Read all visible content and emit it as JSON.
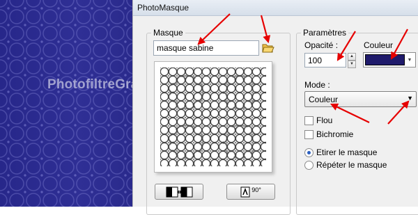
{
  "window": {
    "title": "PhotoMasque"
  },
  "watermark": {
    "text": "PhotofiltreGraph"
  },
  "masque_group": {
    "legend": "Masque",
    "file_name": "masque sabine"
  },
  "params_group": {
    "legend": "Paramètres",
    "opacity_label": "Opacité :",
    "opacity_value": "100",
    "color_label": "Couleur",
    "color_value": "#1f1a6b",
    "mode_label": "Mode :",
    "mode_value": "Couleur",
    "flou_label": "Flou",
    "bichromie_label": "Bichromie",
    "etirer_label": "Etirer le masque",
    "repeter_label": "Répéter le masque"
  },
  "buttons": {
    "rotate_text": "90°"
  },
  "colors": {
    "annotation_arrow": "#e60000",
    "background_pattern": "#2a2a8c"
  }
}
